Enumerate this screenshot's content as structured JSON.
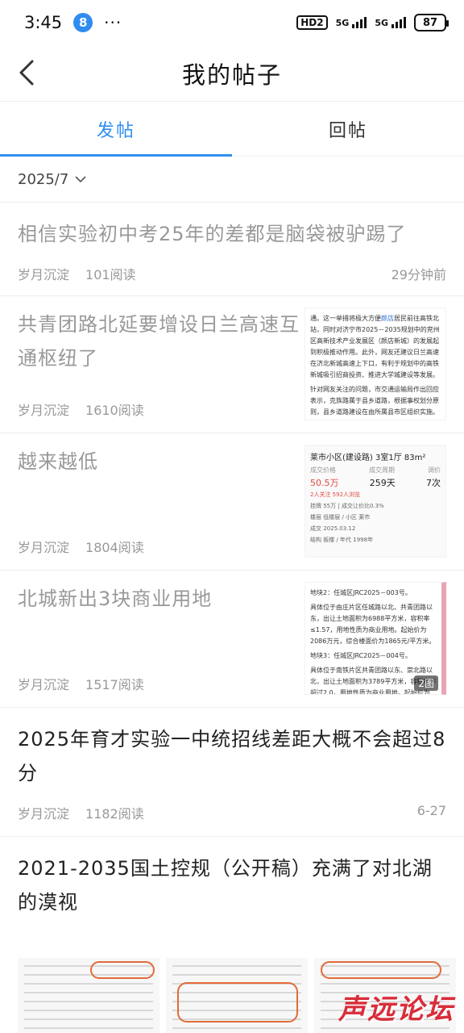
{
  "status": {
    "time": "3:45",
    "badge": "8",
    "dots": "···",
    "hd": "HD2",
    "net1": "5G",
    "net2": "5G",
    "battery": "87"
  },
  "header": {
    "title": "我的帖子"
  },
  "tabs": [
    {
      "label": "发帖",
      "active": true
    },
    {
      "label": "回帖",
      "active": false
    }
  ],
  "date_filter": "2025/7",
  "posts": [
    {
      "title": "相信实验初中考25年的差都是脑袋被驴踢了",
      "author": "岁月沉淀",
      "reads": "101阅读",
      "time": "29分钟前"
    },
    {
      "title": "共青团路北延要增设日兰高速互通枢纽了",
      "author": "岁月沉淀",
      "reads": "1610阅读",
      "thumb_text_1": "通。这一举措将极大方便",
      "thumb_text_hl": "颜店",
      "thumb_text_2": "居民前往高铁北站，同时对济宁市2025－2035规划中的兖州区高新技术产业发展区（颜店新城）的发展起到积极推动作用。此外，网友还建议日兰高速在济北新城高速上下口，有利于规划中的高铁新城吸引招商投资、推进大学城建设等发展。",
      "thumb_text_3": "针对网友关注的问题，市交通运输局作出回应表示，克族路属于县乡道路，根据事权划分原则，县乡道路建设在由所属县市区组织实施。"
    },
    {
      "title": "越来越低",
      "author": "岁月沉淀",
      "reads": "1804阅读",
      "thumb_title": "莱市小区(建设路) 3室1厅 83m²",
      "thumb_labels": [
        "成交价格",
        "成交周期",
        "调价"
      ],
      "thumb_values": [
        "50.5万",
        "259天",
        "7次"
      ],
      "thumb_row_1": "2人关注 592人浏览",
      "thumb_row_2": "挂牌 55万 | 成交让价比0.3%",
      "thumb_row_3": "楼层 低楼层 / 小区 莱市",
      "thumb_row_4": "成交 2025.03.12",
      "thumb_row_5": "结构 板楼 / 年代 1998年"
    },
    {
      "title": "北城新出3块商业用地",
      "author": "岁月沉淀",
      "reads": "1517阅读",
      "thumb_p1": "地块2：任城区JRC2025－003号。",
      "thumb_p2": "具体位于由庄片区任城路以北、共青团路以东，出让土地面积为6988平方米，容积率≤1.57，用地性质为商业用地。起始价为2086万元，综合楼面价为1865元/平方米。",
      "thumb_p3": "地块3：任城区JRC2025－004号。",
      "thumb_p4": "具体位于南铁片区共青团路以东、崇北路以北，出让土地面积为3789平方米，容积率不超过2.0，用地性质为商业用地。起始价为626万元，综合楼面价为",
      "img_count": "2图"
    },
    {
      "title": "2025年育才实验一中统招线差距大概不会超过8分",
      "author": "岁月沉淀",
      "reads": "1182阅读",
      "time": "6-27"
    },
    {
      "title": "2021-2035国土控规（公开稿）充满了对北湖的漠视"
    }
  ],
  "watermark": "声远论坛"
}
